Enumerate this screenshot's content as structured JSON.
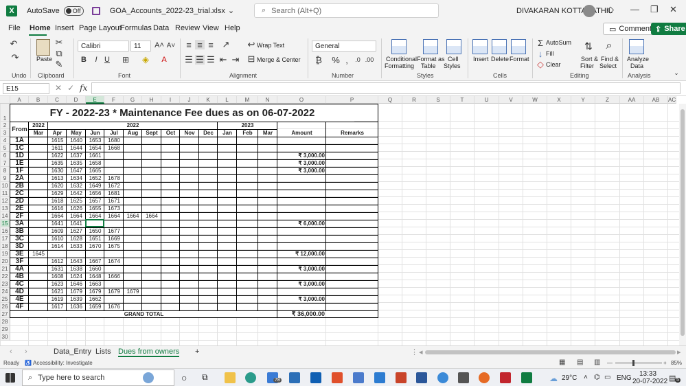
{
  "titlebar": {
    "autosave_label": "AutoSave",
    "autosave_state": "Off",
    "filename": "GOA_Accounts_2022-23_trial.xlsx",
    "search_placeholder": "Search (Alt+Q)",
    "user_name": "DIVAKARAN KOTTARATHIL"
  },
  "menu": {
    "tabs": [
      "File",
      "Home",
      "Insert",
      "Page Layout",
      "Formulas",
      "Data",
      "Review",
      "View",
      "Help"
    ],
    "active": "Home",
    "comments_label": "Comments",
    "share_label": "Share"
  },
  "ribbon": {
    "paste_label": "Paste",
    "font_name": "Calibri",
    "font_size": "11",
    "wrap_text": "Wrap Text",
    "merge_center": "Merge & Center",
    "number_format": "General",
    "conditional_formatting": [
      "Conditional",
      "Formatting"
    ],
    "format_as_table": [
      "Format as",
      "Table"
    ],
    "cell_styles": [
      "Cell",
      "Styles"
    ],
    "insert": "Insert",
    "delete": "Delete",
    "format": "Format",
    "autosum": "AutoSum",
    "fill": "Fill",
    "clear": "Clear",
    "sort_filter": [
      "Sort &",
      "Filter"
    ],
    "find_select": [
      "Find &",
      "Select"
    ],
    "analyze_data": [
      "Analyze",
      "Data"
    ],
    "groups": [
      "Undo",
      "Clipboard",
      "Font",
      "Alignment",
      "Number",
      "Styles",
      "Cells",
      "Editing",
      "Analysis"
    ]
  },
  "formula_bar": {
    "name_box": "E15",
    "formula": "",
    "fx": "fx"
  },
  "sheet": {
    "columns": [
      "A",
      "B",
      "C",
      "D",
      "E",
      "F",
      "G",
      "H",
      "I",
      "J",
      "K",
      "L",
      "M",
      "N",
      "O",
      "P",
      "Q",
      "R",
      "S",
      "T",
      "U",
      "V",
      "W",
      "X",
      "Y",
      "Z",
      "AA",
      "AB",
      "AC"
    ],
    "row_numbers": [
      "1",
      "2",
      "3",
      "4",
      "5",
      "6",
      "7",
      "8",
      "9",
      "10",
      "11",
      "12",
      "13",
      "14",
      "15",
      "16",
      "17",
      "18",
      "19",
      "20",
      "21",
      "22",
      "23",
      "24",
      "25",
      "26",
      "27",
      "28",
      "29",
      "30"
    ],
    "title": "FY - 2022-23 * Maintenance Fee dues as on 06-07-2022",
    "header": {
      "from": "From",
      "year_2022a": "2022",
      "year_2022b": "2022",
      "year_2023": "2023",
      "months": [
        "Mar",
        "Apr",
        "May",
        "Jun",
        "Jul",
        "Aug",
        "Sept",
        "Oct",
        "Nov",
        "Dec",
        "Jan",
        "Feb",
        "Mar"
      ],
      "amount": "Amount",
      "remarks": "Remarks"
    },
    "rows": [
      {
        "flat": "1A",
        "mar": "",
        "apr": "1615",
        "may": "1640",
        "jun": "1653",
        "jul": "1680",
        "aug": "",
        "sep": "",
        "amount": ""
      },
      {
        "flat": "1C",
        "mar": "",
        "apr": "1611",
        "may": "1644",
        "jun": "1654",
        "jul": "1668",
        "aug": "",
        "sep": "",
        "amount": ""
      },
      {
        "flat": "1D",
        "mar": "",
        "apr": "1622",
        "may": "1637",
        "jun": "1661",
        "jul": "",
        "aug": "",
        "sep": "",
        "amount": "₹ 3,000.00"
      },
      {
        "flat": "1E",
        "mar": "",
        "apr": "1635",
        "may": "1635",
        "jun": "1658",
        "jul": "",
        "aug": "",
        "sep": "",
        "amount": "₹ 3,000.00"
      },
      {
        "flat": "1F",
        "mar": "",
        "apr": "1630",
        "may": "1647",
        "jun": "1665",
        "jul": "",
        "aug": "",
        "sep": "",
        "amount": "₹ 3,000.00"
      },
      {
        "flat": "2A",
        "mar": "",
        "apr": "1613",
        "may": "1634",
        "jun": "1652",
        "jul": "1678",
        "aug": "",
        "sep": "",
        "amount": ""
      },
      {
        "flat": "2B",
        "mar": "",
        "apr": "1620",
        "may": "1632",
        "jun": "1649",
        "jul": "1672",
        "aug": "",
        "sep": "",
        "amount": ""
      },
      {
        "flat": "2C",
        "mar": "",
        "apr": "1629",
        "may": "1642",
        "jun": "1656",
        "jul": "1681",
        "aug": "",
        "sep": "",
        "amount": ""
      },
      {
        "flat": "2D",
        "mar": "",
        "apr": "1618",
        "may": "1625",
        "jun": "1657",
        "jul": "1671",
        "aug": "",
        "sep": "",
        "amount": ""
      },
      {
        "flat": "2E",
        "mar": "",
        "apr": "1616",
        "may": "1626",
        "jun": "1655",
        "jul": "1673",
        "aug": "",
        "sep": "",
        "amount": ""
      },
      {
        "flat": "2F",
        "mar": "",
        "apr": "1664",
        "may": "1664",
        "jun": "1664",
        "jul": "1664",
        "aug": "1664",
        "sep": "1664",
        "amount": ""
      },
      {
        "flat": "3A",
        "mar": "",
        "apr": "1641",
        "may": "1641",
        "jun": "",
        "jul": "",
        "aug": "",
        "sep": "",
        "amount": "₹ 6,000.00"
      },
      {
        "flat": "3B",
        "mar": "",
        "apr": "1609",
        "may": "1627",
        "jun": "1650",
        "jul": "1677",
        "aug": "",
        "sep": "",
        "amount": ""
      },
      {
        "flat": "3C",
        "mar": "",
        "apr": "1610",
        "may": "1628",
        "jun": "1651",
        "jul": "1669",
        "aug": "",
        "sep": "",
        "amount": ""
      },
      {
        "flat": "3D",
        "mar": "",
        "apr": "1614",
        "may": "1633",
        "jun": "1670",
        "jul": "1675",
        "aug": "",
        "sep": "",
        "amount": ""
      },
      {
        "flat": "3E",
        "mar": "1645",
        "apr": "",
        "may": "",
        "jun": "",
        "jul": "",
        "aug": "",
        "sep": "",
        "amount": "₹ 12,000.00"
      },
      {
        "flat": "3F",
        "mar": "",
        "apr": "1612",
        "may": "1643",
        "jun": "1667",
        "jul": "1674",
        "aug": "",
        "sep": "",
        "amount": ""
      },
      {
        "flat": "4A",
        "mar": "",
        "apr": "1631",
        "may": "1638",
        "jun": "1660",
        "jul": "",
        "aug": "",
        "sep": "",
        "amount": "₹ 3,000.00"
      },
      {
        "flat": "4B",
        "mar": "",
        "apr": "1608",
        "may": "1624",
        "jun": "1648",
        "jul": "1666",
        "aug": "",
        "sep": "",
        "amount": ""
      },
      {
        "flat": "4C",
        "mar": "",
        "apr": "1623",
        "may": "1646",
        "jun": "1663",
        "jul": "",
        "aug": "",
        "sep": "",
        "amount": "₹ 3,000.00"
      },
      {
        "flat": "4D",
        "mar": "",
        "apr": "1621",
        "may": "1679",
        "jun": "1679",
        "jul": "1679",
        "aug": "1679",
        "sep": "",
        "amount": ""
      },
      {
        "flat": "4E",
        "mar": "",
        "apr": "1619",
        "may": "1639",
        "jun": "1662",
        "jul": "",
        "aug": "",
        "sep": "",
        "amount": "₹ 3,000.00"
      },
      {
        "flat": "4F",
        "mar": "",
        "apr": "1617",
        "may": "1636",
        "jun": "1659",
        "jul": "1676",
        "aug": "",
        "sep": "",
        "amount": ""
      }
    ],
    "grand_total_label": "GRAND TOTAL",
    "grand_total": "₹ 36,000.00"
  },
  "sheet_tabs": {
    "tabs": [
      "Data_Entry",
      "Lists",
      "Dues from owners"
    ],
    "active": "Dues from owners",
    "add": "+"
  },
  "status_bar": {
    "ready": "Ready",
    "accessibility": "Accessibility: Investigate",
    "zoom": "85%"
  },
  "taskbar": {
    "search_placeholder": "Type here to search",
    "badge": "78",
    "temperature": "29°C",
    "language": "ENG",
    "time": "13:33",
    "date": "20-07-2022",
    "notifications": "5"
  },
  "colors": {
    "excel_green": "#107c41",
    "ribbon_bg": "#f3f3f3"
  }
}
